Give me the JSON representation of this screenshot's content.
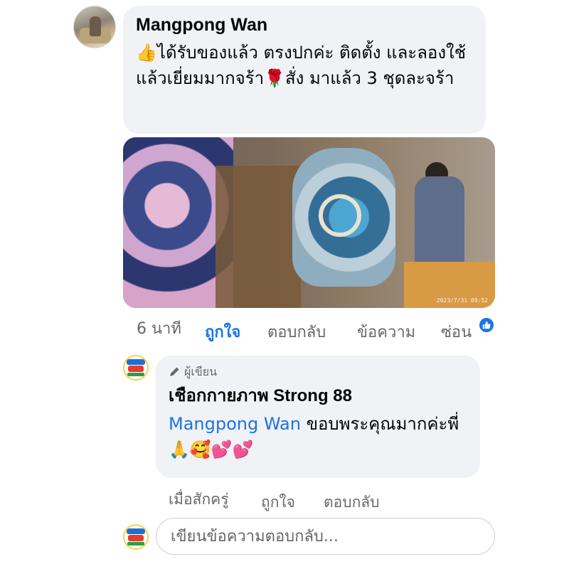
{
  "comment": {
    "author": "Mangpong Wan",
    "text": "👍ได้รับของแล้ว ตรงปกค่ะ ติดตั้ง และลองใช้แล้วเยี่ยมมากจร้า🌹สั่ง มาแล้ว 3 ชุดละจร้า",
    "photo_timestamp": "2023/7/31 09:52",
    "time": "6 นาที",
    "like_label": "ถูกใจ",
    "reply_label": "ตอบกลับ",
    "message_label": "ข้อความ",
    "hide_label": "ซ่อน",
    "reaction_icon": "like-icon",
    "accent_color": "#1b74e4"
  },
  "reply": {
    "author_badge": "ผู้เขียน",
    "author": "เชือกกายภาพ Strong 88",
    "mention": "Mangpong Wan",
    "text": " ขอบพระคุณมากค่ะพี่ 🙏🥰💕💕",
    "time": "เมื่อสักครู่",
    "like_label": "ถูกใจ",
    "reply_label": "ตอบกลับ"
  },
  "composer": {
    "placeholder": "เขียนข้อความตอบกลับ..."
  }
}
